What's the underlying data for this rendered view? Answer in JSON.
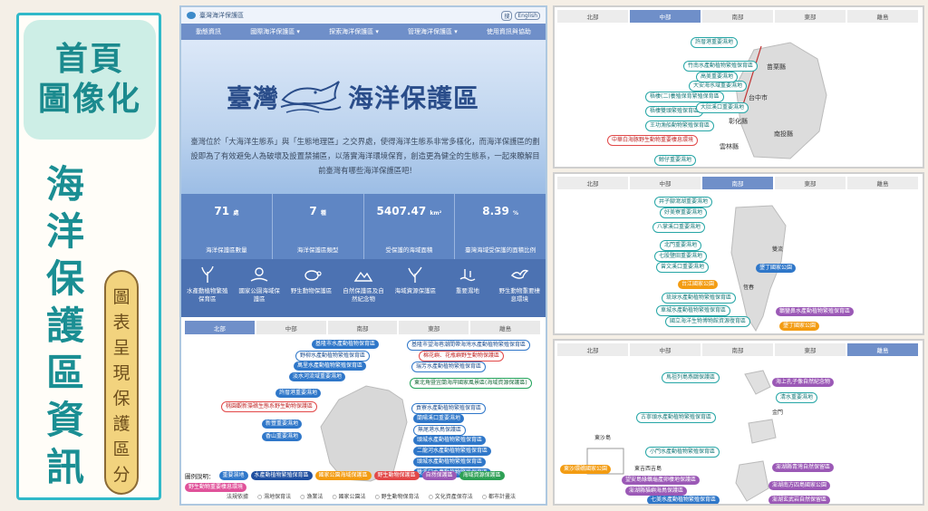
{
  "left": {
    "hero_line1": "首頁",
    "hero_line2": "圖像化",
    "vertical_title": [
      "海",
      "洋",
      "保",
      "護",
      "區",
      "資",
      "訊"
    ],
    "pill_text": [
      "圖",
      "表",
      "呈",
      "現",
      "保",
      "護",
      "區",
      "分",
      "佈"
    ]
  },
  "site": {
    "title": "臺灣海洋保護區",
    "search_btn": "搜",
    "lang": "English",
    "nav": [
      "動態資訊",
      "國際海洋保護區 ▾",
      "探索海洋保護區 ▾",
      "管理海洋保護區 ▾",
      "使用資訊與協助"
    ],
    "brand1": "臺灣",
    "brand2": "海洋保護區",
    "intro": "臺灣位於「大海洋生態系」與「生態地理區」之交界處，使得海洋生態系非常多樣化，而海洋保護區的劃設即為了有效避免人為破壞及設置禁捕區，以落實海洋環境保育，創造更為健全的生態系，一起來瞭解目前臺灣有哪些海洋保護區吧!",
    "stats": [
      {
        "value": "71",
        "unit": "處",
        "label": "海洋保護區數量"
      },
      {
        "value": "7",
        "unit": "種",
        "label": "海洋保護區類型"
      },
      {
        "value": "5407.47",
        "unit": "km²",
        "label": "受保護的海域面積"
      },
      {
        "value": "8.39",
        "unit": "%",
        "label": "臺灣海域受保護的面積比例"
      }
    ],
    "categories": [
      {
        "label": "水產動植物繁殖保育區",
        "icon": "plant-icon"
      },
      {
        "label": "國家公園海域保護區",
        "icon": "sun-beach-icon"
      },
      {
        "label": "野生動物保護區",
        "icon": "turtle-icon"
      },
      {
        "label": "自然保護區及自然紀念物",
        "icon": "landscape-icon"
      },
      {
        "label": "海域資源保護區",
        "icon": "coral-icon"
      },
      {
        "label": "重要濕地",
        "icon": "wetland-icon"
      },
      {
        "label": "野生動物重要棲息環境",
        "icon": "bird-icon"
      }
    ],
    "tabs": [
      "北部",
      "中部",
      "南部",
      "東部",
      "離島"
    ],
    "north_labels": [
      "基隆市水產動植物保育區",
      "野柳水產動植物繁殖保育區",
      "萬里水產動植物繁殖保育區",
      "淡水河流域重要濕地",
      "許厝港重要濕地",
      "桃園觀新藻礁生態系野生動物保護區",
      "新豐重要濕地",
      "香山重要濕地",
      "基隆市望海巷潮間帶海灣水產動植物繁殖保育區",
      "棉花嶼、花瓶嶼野生動物保護區",
      "瑞芳水產動植物繁殖保育區",
      "東北角暨宜蘭海岸國家風景區(海域資源保護區)",
      "貢寮水產動植物繁殖保育區",
      "蘭陽溪口重要濕地",
      "無尾港水鳥保護區",
      "頭城水產動植物繁殖保育區",
      "二龍河水產動植物繁殖保育區",
      "頭城水產動植物繁殖保育區",
      "雙溪口水產動植物繁殖保育區"
    ],
    "legend_label": "圖例說明：",
    "legend": [
      "重要濕地",
      "水產動植物繁殖保育區",
      "國家公園海域保護區",
      "野生動物保護區",
      "自然保護區",
      "海域資源保護區",
      "野生動物重要棲息環境"
    ],
    "legend2": [
      "法規依據",
      "○ 濕地保育法",
      "○ 漁業法",
      "○ 國家公園法",
      "○ 野生動物保育法",
      "○ 文化資產保存法",
      "○ 都市計畫法"
    ]
  },
  "central": {
    "tabs": [
      "北部",
      "中部",
      "南部",
      "東部",
      "離島"
    ],
    "labels": [
      "許厝港重要濕地",
      "竹南水產動植物繁殖保育區",
      "苗栗縣",
      "大安海水域重要濕地",
      "梧棲(二)養殖保育繁殖保育區",
      "台中市",
      "梧棲雙頭繁殖保育區",
      "彰化縣",
      "王功漁船動物繁殖保育區",
      "南投縣",
      "雲林縣",
      "中華白海豚野生動物重要棲息環境",
      "鯨仔重要濕地",
      "高美重要濕地",
      "大肚溪口重要濕地"
    ]
  },
  "south": {
    "tabs": [
      "北部",
      "中部",
      "南部",
      "東部",
      "離島"
    ],
    "labels": [
      "井子腳瀉湖重要濕地",
      "好美寮重要濕地",
      "八掌溪口重要濕地",
      "北門重要濕地",
      "七股鹽田重要濕地",
      "曾文溪口重要濕地",
      "台江國家公園",
      "琉球水產動植物繁殖保育區",
      "車城水產動植物繁殖保育區",
      "國立海洋生物博物館資源復育區",
      "鵝鑾鼻水產動植物繁殖保育區",
      "墾丁國家公園",
      "雙流",
      "墾丁國家公園",
      "恆春"
    ]
  },
  "islands": {
    "tabs": [
      "北部",
      "中部",
      "南部",
      "東部",
      "離島"
    ],
    "labels": [
      "馬祖列島燕鷗保護區",
      "海上孔子像自然紀念物",
      "清水重要濕地",
      "金門",
      "古寧頭水產動植物繁殖保育區",
      "東沙環礁國家公園",
      "東沙島",
      "小門水產動植物繁殖保育區",
      "望安島綠蠵龜產卵棲地保護區",
      "澎湖南方四島國家公園",
      "七美水產動植物繁殖保育區",
      "澎湖縣貓嶼海鳥保護區",
      "澎湖玄武岩自然保留區",
      "東吉西吉島",
      "澎湖縣青灣自然保留區"
    ]
  }
}
